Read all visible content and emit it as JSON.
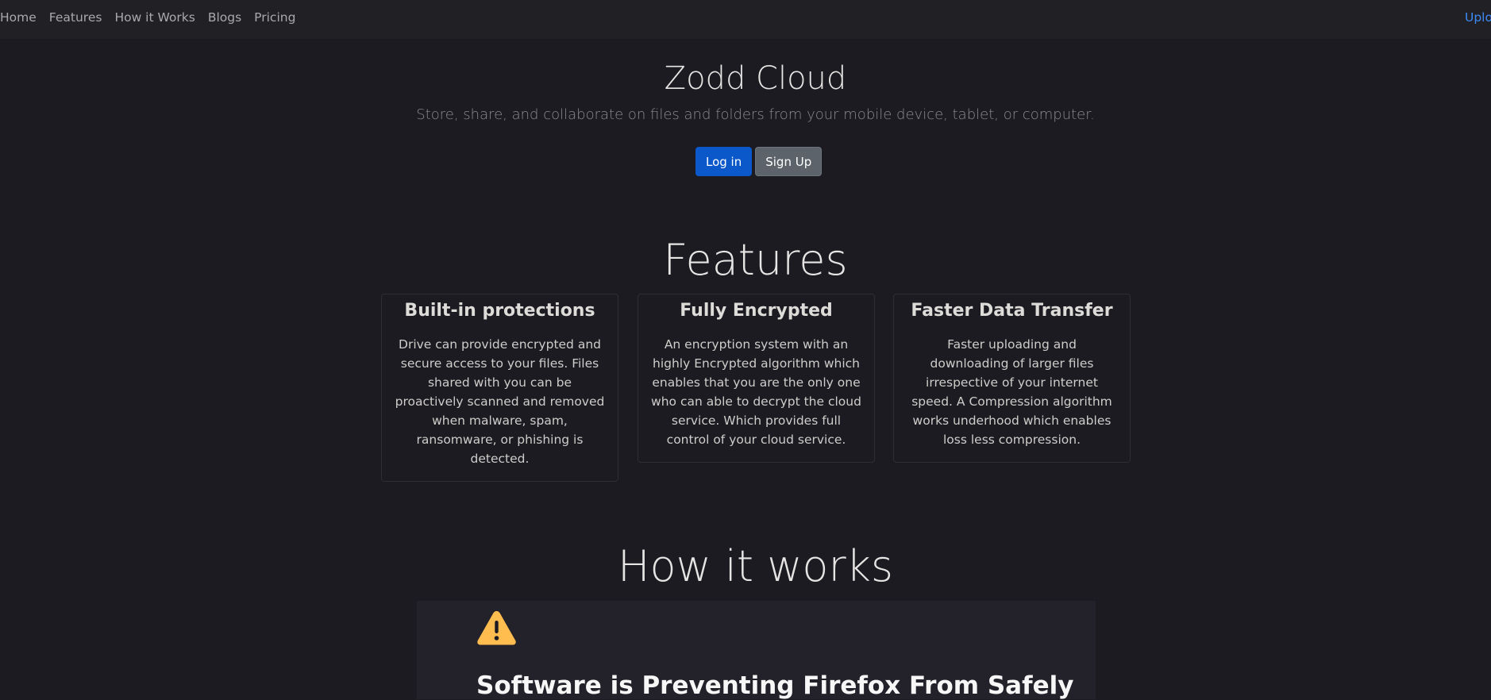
{
  "nav": {
    "links": [
      "Home",
      "Features",
      "How it Works",
      "Blogs",
      "Pricing"
    ],
    "upload": "Uplo"
  },
  "hero": {
    "title": "Zodd Cloud",
    "subtitle": "Store, share, and collaborate on files and folders from your mobile device, tablet, or computer.",
    "login_label": "Log in",
    "signup_label": "Sign Up"
  },
  "features": {
    "heading": "Features",
    "cards": [
      {
        "title": "Built-in protections",
        "text": "Drive can provide encrypted and secure access to your files. Files shared with you can be proactively scanned and removed when malware, spam, ransomware, or phishing is detected."
      },
      {
        "title": "Fully Encrypted",
        "text": "An encryption system with an highly Encrypted algorithm which enables that you are the only one who can able to decrypt the cloud service. Which provides full control of your cloud service."
      },
      {
        "title": "Faster Data Transfer",
        "text": "Faster uploading and downloading of larger files irrespective of your internet speed. A Compression algorithm works underhood which enables loss less compression."
      }
    ]
  },
  "how_it_works": {
    "heading": "How it works",
    "error_icon": "warning-triangle-icon",
    "error_title": "Software is Preventing Firefox From Safely"
  },
  "colors": {
    "background": "#1c1b22",
    "navbar": "#212125",
    "primary": "#0a58ca",
    "secondary": "#5c636a",
    "link_accent": "#3d8af7",
    "warning": "#ffbd4f"
  }
}
